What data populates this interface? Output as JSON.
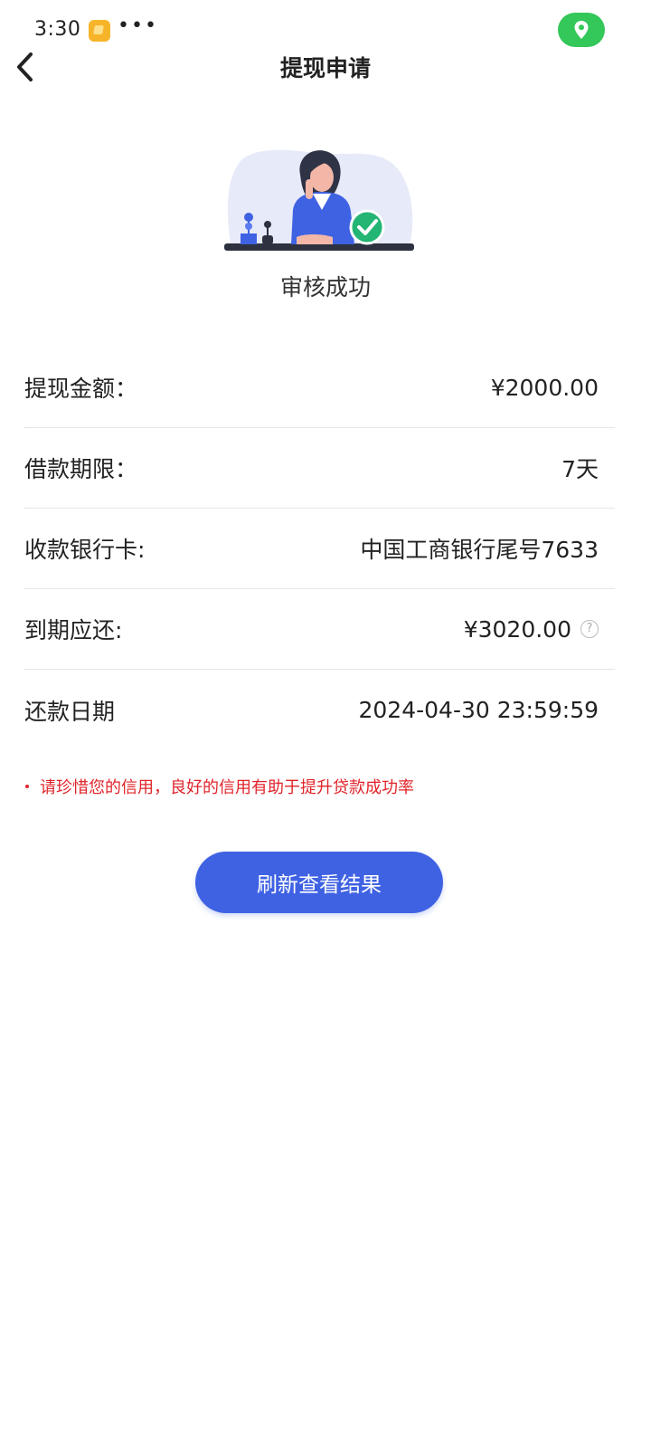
{
  "status_bar": {
    "time": "3:30",
    "dots": "•••",
    "app_icon": "notes-app-icon",
    "location_icon": "location-pin-icon",
    "location_color": "#34c759"
  },
  "header": {
    "title": "提现申请",
    "back_icon": "chevron-left-icon"
  },
  "result": {
    "status": "审核成功",
    "illustration": "woman-at-desk-with-checkmark",
    "check_color": "#22b573"
  },
  "details": [
    {
      "label": "提现金额：",
      "value": "¥2000.00"
    },
    {
      "label": "借款期限：",
      "value": "7天"
    },
    {
      "label": "收款银行卡:",
      "value": "中国工商银行尾号7633"
    },
    {
      "label": "到期应还:",
      "value": "¥3020.00",
      "help_icon": "question-circle-icon"
    },
    {
      "label": "还款日期",
      "value": "2024-04-30 23:59:59"
    }
  ],
  "notice": {
    "text": "请珍惜您的信用，良好的信用有助于提升贷款成功率",
    "color": "#e0242b"
  },
  "actions": {
    "refresh_label": "刷新查看结果",
    "button_color": "#3f62e3"
  }
}
